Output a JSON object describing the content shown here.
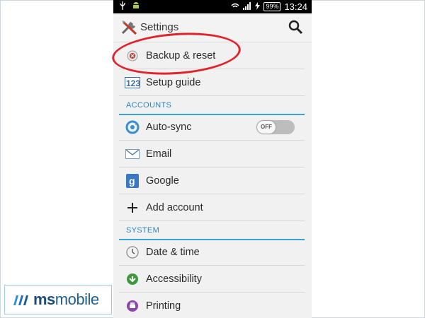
{
  "status_bar": {
    "battery": "99%",
    "time": "13:24",
    "icons": [
      "usb-icon",
      "android-icon",
      "wifi-icon",
      "signal-icon",
      "charging-icon"
    ]
  },
  "action_bar": {
    "title": "Settings",
    "app_icon": "settings-tools-icon",
    "search_icon": "search-icon"
  },
  "items_top": [
    {
      "label": "Backup & reset",
      "icon": "backup-reset-icon"
    },
    {
      "label": "Setup guide",
      "icon": "setup-guide-icon"
    }
  ],
  "accounts": {
    "header": "ACCOUNTS",
    "items": [
      {
        "label": "Auto-sync",
        "icon": "auto-sync-icon",
        "toggle": "OFF"
      },
      {
        "label": "Email",
        "icon": "email-icon"
      },
      {
        "label": "Google",
        "icon": "google-icon"
      },
      {
        "label": "Add account",
        "icon": "plus-icon"
      }
    ]
  },
  "system": {
    "header": "SYSTEM",
    "items": [
      {
        "label": "Date & time",
        "icon": "clock-icon"
      },
      {
        "label": "Accessibility",
        "icon": "accessibility-icon"
      },
      {
        "label": "Printing",
        "icon": "printing-icon"
      }
    ]
  },
  "watermark": {
    "brand_bold": "ms",
    "brand_rest": "mobile"
  },
  "colors": {
    "accent_line": "#3aa3d0",
    "header_text": "#2d86c0",
    "highlight": "#e0242b",
    "toggle_bg": "#bdbdbd"
  }
}
